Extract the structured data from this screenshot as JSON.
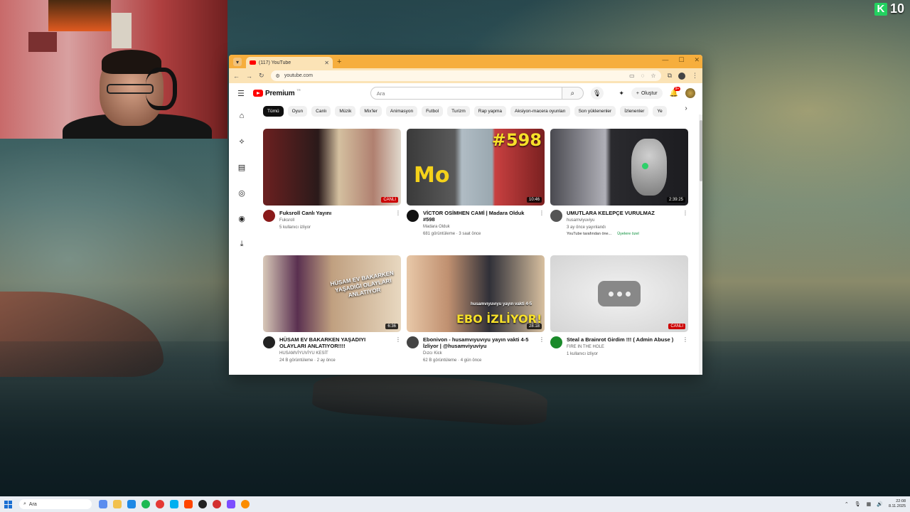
{
  "overlay": {
    "corner_badge": "10"
  },
  "browser": {
    "tab_title": "(117) YouTube",
    "url": "youtube.com"
  },
  "youtube": {
    "logo_text": "Premium",
    "logo_sup": "TR",
    "search_placeholder": "Ara",
    "create_label": "Oluştur",
    "notif_count": "9+",
    "chips": [
      "Tümü",
      "Oyun",
      "Canlı",
      "Müzik",
      "Mix'ler",
      "Animasyon",
      "Futbol",
      "Turizm",
      "Rap yapma",
      "Aksiyon-macera oyunları",
      "Son yüklenenler",
      "İzlenenler",
      "Ye"
    ],
    "videos": [
      {
        "title": "Fuksroll Canlı Yayını",
        "channel": "Fuksroll",
        "stats": "5 kullanıcı izliyor",
        "badge": "CANLI",
        "live": true
      },
      {
        "title": "VİCTOR OSİMHEN CAMİ | Madara Olduk #598",
        "channel": "Madara Olduk",
        "stats": "681 görüntüleme · 3 saat önce",
        "badge": "10:46",
        "live": false
      },
      {
        "title": "UMUTLARA KELEPÇE VURULMAZ",
        "channel": "husamviyuviyu",
        "stats": "3 ay önce yayınlandı",
        "badge": "2:39:25",
        "live": false,
        "extra1": "YouTube tarafından öne...",
        "extra2": "Üyelere özel"
      },
      {
        "title": "HÜSAM EV BAKARKEN YAŞADIYI OLAYLARI ANLATIYOR!!!!",
        "channel": "HUSAMVİYUVİYU KESİT",
        "stats": "24 B görüntüleme · 2 ay önce",
        "badge": "6:36",
        "live": false
      },
      {
        "title": "Ebonivon - husamvıyuvıyu yayın vakti 4-5 İzliyor | @husamviyuviyu",
        "channel": "Dızcı Kick",
        "stats": "62 B görüntüleme · 4 gün önce",
        "badge": "28:18",
        "live": false
      },
      {
        "title": "Steal a Brainrot Girdim !!! ( Admin Abuse )",
        "channel": "FIRE IN THE HOLE",
        "stats": "1 kullanıcı izliyor",
        "badge": "CANLI",
        "live": true
      }
    ],
    "thumb_text": {
      "num": "#598",
      "mo": "Mo",
      "ebo": "EBO İZLİYOR!",
      "ebo_sub": "husamvıyuvıyu yayın vakti 4-5",
      "hus": "HÜSAM EV BAKARKEN YAŞADIĞI OLAYLARI ANLATIYOR"
    }
  },
  "taskbar": {
    "search_placeholder": "Ara",
    "time": "22:08",
    "date": "8.11.2025"
  }
}
